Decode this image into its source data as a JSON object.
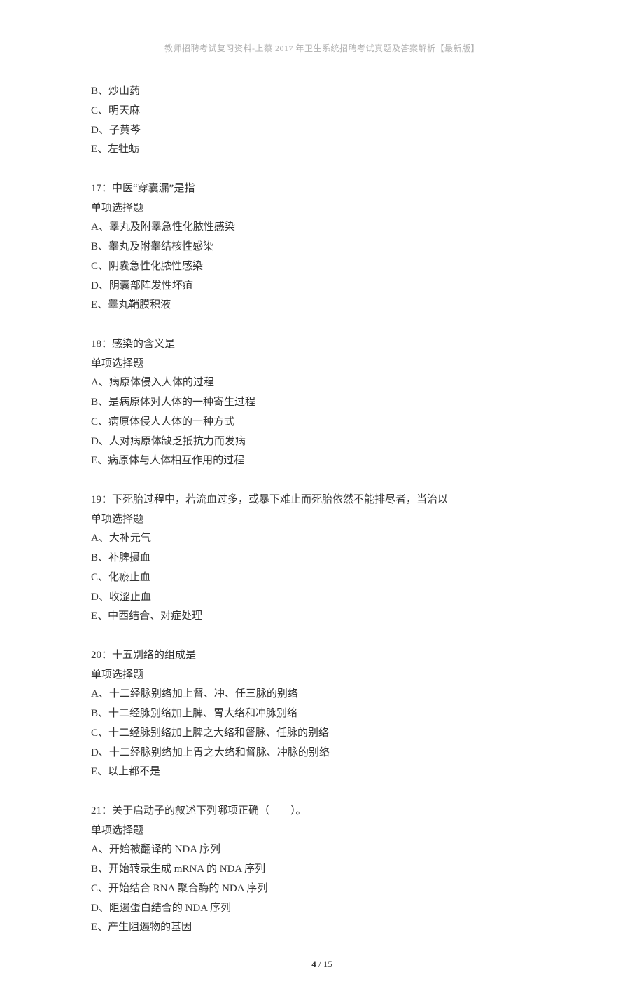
{
  "header": "教师招聘考试复习资料-上蔡 2017 年卫生系统招聘考试真题及答案解析【最新版】",
  "footer_page": "4",
  "footer_total": "15",
  "lines": [
    "B、炒山药",
    "C、明天麻",
    "D、子黄芩",
    "E、左牡蛎",
    "",
    "17：中医“穿囊漏”是指",
    "单项选择题",
    "A、睾丸及附睾急性化脓性感染",
    "B、睾丸及附睾结核性感染",
    "C、阴囊急性化脓性感染",
    "D、阴囊部阵发性坏疽",
    "E、睾丸鞘膜积液",
    "",
    "18：感染的含义是",
    "单项选择题",
    "A、病原体侵入人体的过程",
    "B、是病原体对人体的一种寄生过程",
    "C、病原体侵人人体的一种方式",
    "D、人对病原体缺乏抵抗力而发病",
    "E、病原体与人体相互作用的过程",
    "",
    "19：下死胎过程中，若流血过多，或暴下难止而死胎依然不能排尽者，当治以",
    "单项选择题",
    "A、大补元气",
    "B、补脾摄血",
    "C、化瘀止血",
    "D、收涩止血",
    "E、中西结合、对症处理",
    "",
    "20：十五别络的组成是",
    "单项选择题",
    "A、十二经脉别络加上督、冲、任三脉的别络",
    "B、十二经脉别络加上脾、胃大络和冲脉别络",
    "C、十二经脉别络加上脾之大络和督脉、任脉的别络",
    "D、十二经脉别络加上胃之大络和督脉、冲脉的别络",
    "E、以上都不是",
    "",
    "21：关于启动子的叙述下列哪项正确（　　）。",
    "单项选择题",
    "A、开始被翻译的 NDA 序列",
    "B、开始转录生成 mRNA 的 NDA 序列",
    "C、开始结合 RNA 聚合酶的 NDA 序列",
    "D、阻遏蛋白结合的 NDA 序列",
    "E、产生阻遏物的基因"
  ]
}
